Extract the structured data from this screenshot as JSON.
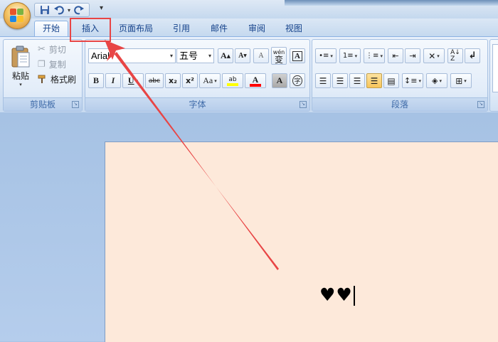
{
  "quick_access": {
    "icons": [
      "save-icon",
      "undo-icon",
      "redo-icon",
      "customize-qat-icon"
    ]
  },
  "tabs": [
    {
      "label": "开始",
      "active": true
    },
    {
      "label": "插入",
      "highlighted": true
    },
    {
      "label": "页面布局"
    },
    {
      "label": "引用"
    },
    {
      "label": "邮件"
    },
    {
      "label": "审阅"
    },
    {
      "label": "视图"
    }
  ],
  "clipboard": {
    "group_label": "剪贴板",
    "paste_label": "粘贴",
    "cut_label": "剪切",
    "copy_label": "复制",
    "format_painter_label": "格式刷"
  },
  "font": {
    "group_label": "字体",
    "font_name": "Arial",
    "font_size": "五号",
    "buttons": {
      "bold": "B",
      "italic": "I",
      "underline": "U",
      "strike": "abc",
      "subscript": "x₂",
      "superscript": "x²",
      "change_case": "Aa",
      "grow": "A",
      "shrink": "A",
      "clear": "A",
      "phonetic": "wén",
      "phonetic_char": "变",
      "border": "A",
      "highlight": "ab",
      "color": "A",
      "shade": "A",
      "enclose": "字"
    },
    "highlight_color": "#ffff00",
    "font_color": "#ff0000"
  },
  "paragraph": {
    "group_label": "段落"
  },
  "document": {
    "text": "♥♥"
  },
  "colors": {
    "highlight_box": "#e84545",
    "page_background": "#fde9da"
  }
}
